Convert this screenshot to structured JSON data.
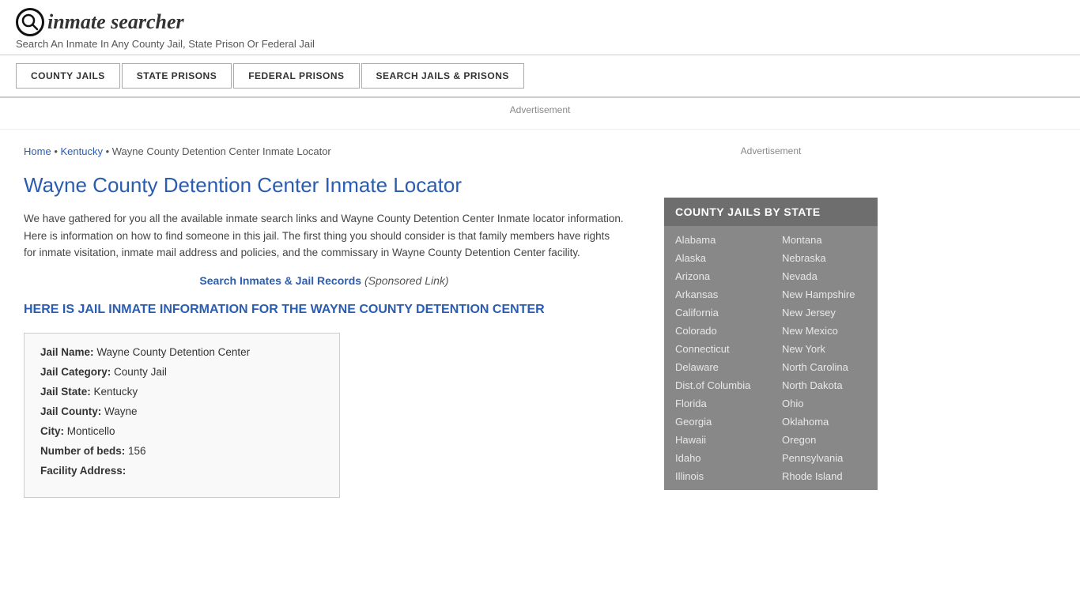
{
  "header": {
    "logo_icon": "🔍",
    "logo_text": "inmate searcher",
    "tagline": "Search An Inmate In Any County Jail, State Prison Or Federal Jail"
  },
  "nav": {
    "items": [
      {
        "label": "COUNTY JAILS"
      },
      {
        "label": "STATE PRISONS"
      },
      {
        "label": "FEDERAL PRISONS"
      },
      {
        "label": "SEARCH JAILS & PRISONS"
      }
    ]
  },
  "ad_bar": {
    "label": "Advertisement"
  },
  "breadcrumb": {
    "home": "Home",
    "state": "Kentucky",
    "current": "Wayne County Detention Center Inmate Locator"
  },
  "page_title": "Wayne County Detention Center Inmate Locator",
  "intro_text": "We have gathered for you all the available inmate search links and Wayne County Detention Center Inmate locator information. Here is information on how to find someone in this jail. The first thing you should consider is that family members have rights for inmate visitation, inmate mail address and policies, and the commissary in Wayne County Detention Center facility.",
  "sponsored": {
    "link_text": "Search Inmates & Jail Records",
    "label": "(Sponsored Link)"
  },
  "section_heading": "HERE IS JAIL INMATE INFORMATION FOR THE WAYNE COUNTY DETENTION CENTER",
  "jail_info": {
    "rows": [
      {
        "label": "Jail Name:",
        "value": "Wayne County Detention Center"
      },
      {
        "label": "Jail Category:",
        "value": "County Jail"
      },
      {
        "label": "Jail State:",
        "value": "Kentucky"
      },
      {
        "label": "Jail County:",
        "value": "Wayne"
      },
      {
        "label": "City:",
        "value": "Monticello"
      },
      {
        "label": "Number of beds:",
        "value": "156"
      },
      {
        "label": "Facility Address:",
        "value": ""
      }
    ]
  },
  "sidebar": {
    "ad_label": "Advertisement",
    "state_list_header": "COUNTY JAILS BY STATE",
    "states_col1": [
      "Alabama",
      "Alaska",
      "Arizona",
      "Arkansas",
      "California",
      "Colorado",
      "Connecticut",
      "Delaware",
      "Dist.of Columbia",
      "Florida",
      "Georgia",
      "Hawaii",
      "Idaho",
      "Illinois"
    ],
    "states_col2": [
      "Montana",
      "Nebraska",
      "Nevada",
      "New Hampshire",
      "New Jersey",
      "New Mexico",
      "New York",
      "North Carolina",
      "North Dakota",
      "Ohio",
      "Oklahoma",
      "Oregon",
      "Pennsylvania",
      "Rhode Island"
    ]
  }
}
